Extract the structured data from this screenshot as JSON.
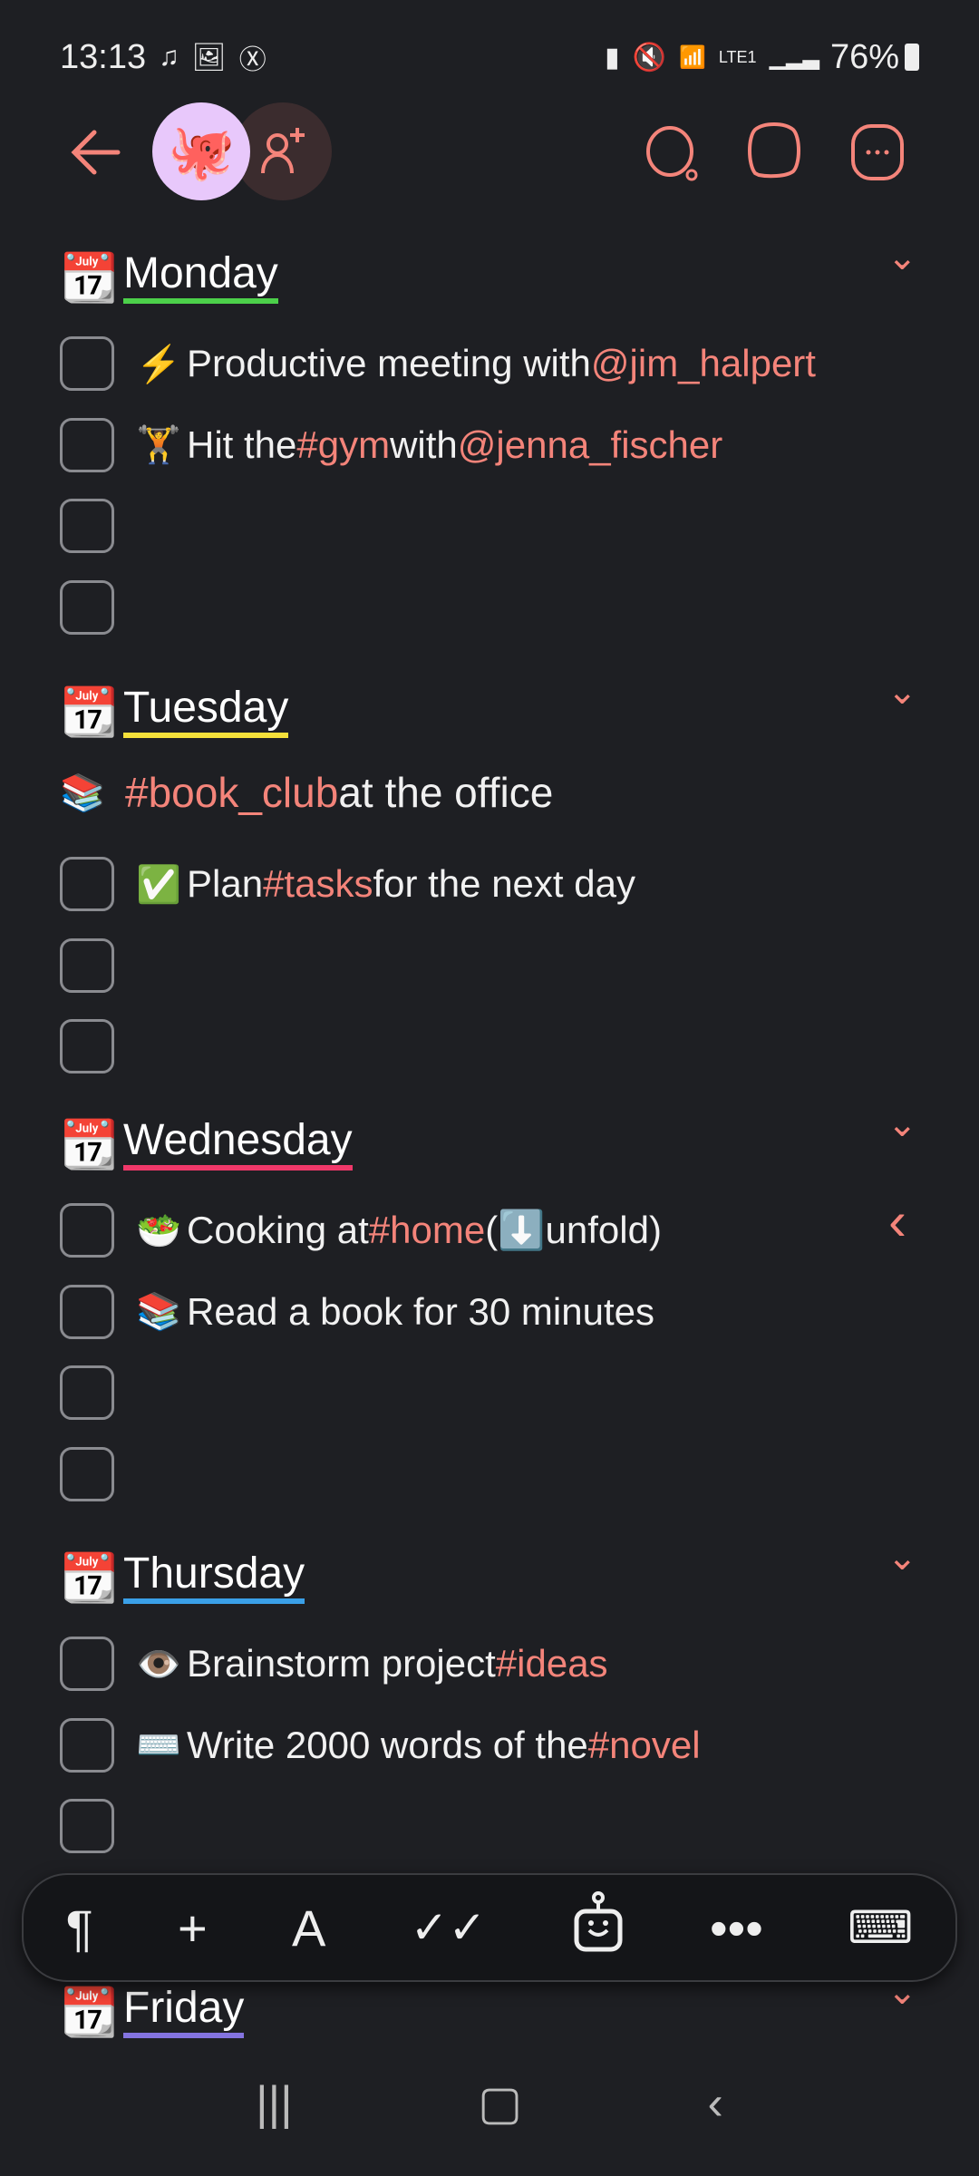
{
  "status": {
    "time": "13:13",
    "battery": "76%",
    "icons": [
      "music-lock-icon",
      "gallery-icon",
      "x-icon",
      "battery-saver-icon",
      "mute-icon",
      "wifi-icon",
      "volte-icon",
      "signal-icon",
      "battery-icon"
    ]
  },
  "header": {
    "icons": [
      "back-arrow-icon",
      "octopus-avatar",
      "add-user-icon",
      "search-icon",
      "comment-icon",
      "more-icon"
    ]
  },
  "colors": {
    "accent": "#f4847a",
    "background": "#1e1f23",
    "monday": "#4cd04a",
    "tuesday": "#f5e03a",
    "wednesday": "#f0386a",
    "thursday": "#3aa0e8",
    "friday": "#8474e0"
  },
  "days": [
    {
      "name": "Monday",
      "items": [
        {
          "emoji": "⚡",
          "parts": [
            {
              "t": "Productive meeting with "
            },
            {
              "t": "@jim_halpert",
              "tag": true
            }
          ]
        },
        {
          "emoji": "🏋️",
          "parts": [
            {
              "t": "Hit the "
            },
            {
              "t": "#gym",
              "tag": true
            },
            {
              "t": " with "
            },
            {
              "t": "@jenna_fischer",
              "tag": true
            }
          ]
        },
        {
          "parts": []
        },
        {
          "parts": []
        }
      ]
    },
    {
      "name": "Tuesday",
      "note": {
        "emoji": "📚",
        "parts": [
          {
            "t": "#book_club",
            "tag": true
          },
          {
            "t": " at the office"
          }
        ]
      },
      "items": [
        {
          "emoji": "✅",
          "parts": [
            {
              "t": "Plan "
            },
            {
              "t": "#tasks",
              "tag": true
            },
            {
              "t": " for the next day"
            }
          ]
        },
        {
          "parts": []
        },
        {
          "parts": []
        }
      ]
    },
    {
      "name": "Wednesday",
      "items": [
        {
          "emoji": "🥗",
          "parts": [
            {
              "t": "Cooking at "
            },
            {
              "t": "#home",
              "tag": true
            },
            {
              "t": " ("
            },
            {
              "t": "⬇️"
            },
            {
              "t": " unfold)"
            }
          ],
          "collapsed": true
        },
        {
          "emoji": "📚",
          "parts": [
            {
              "t": "Read a book for 30 minutes"
            }
          ]
        },
        {
          "parts": []
        },
        {
          "parts": []
        }
      ]
    },
    {
      "name": "Thursday",
      "items": [
        {
          "emoji": "👁️",
          "parts": [
            {
              "t": "Brainstorm project "
            },
            {
              "t": "#ideas",
              "tag": true
            }
          ]
        },
        {
          "emoji": "⌨️",
          "parts": [
            {
              "t": "Write 2000 words of the "
            },
            {
              "t": "#novel",
              "tag": true
            }
          ]
        },
        {
          "parts": []
        }
      ]
    },
    {
      "name": "Friday",
      "items": []
    }
  ],
  "toolbar": {
    "items": [
      "paragraph-icon",
      "plus-icon",
      "text-format-icon",
      "checklist-icon",
      "ai-bot-icon",
      "more-dots-icon",
      "hide-keyboard-icon"
    ]
  }
}
